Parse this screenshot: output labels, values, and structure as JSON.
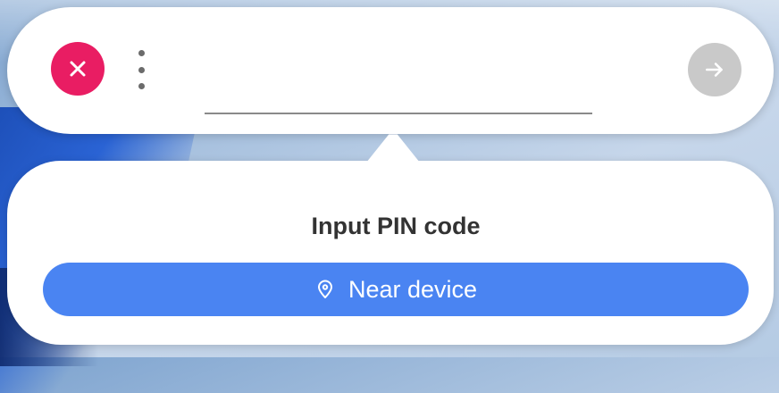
{
  "colors": {
    "close_button": "#e91d63",
    "submit_button_disabled": "#c9c9c9",
    "near_device_button": "#4a84f2",
    "title_text": "#333333"
  },
  "pin_input": {
    "value": "",
    "placeholder": ""
  },
  "icons": {
    "close": "close-icon",
    "more": "more-vertical-icon",
    "submit": "arrow-right-icon",
    "location": "location-pin-icon"
  },
  "panel": {
    "title": "Input PIN code",
    "near_device_label": "Near device"
  }
}
